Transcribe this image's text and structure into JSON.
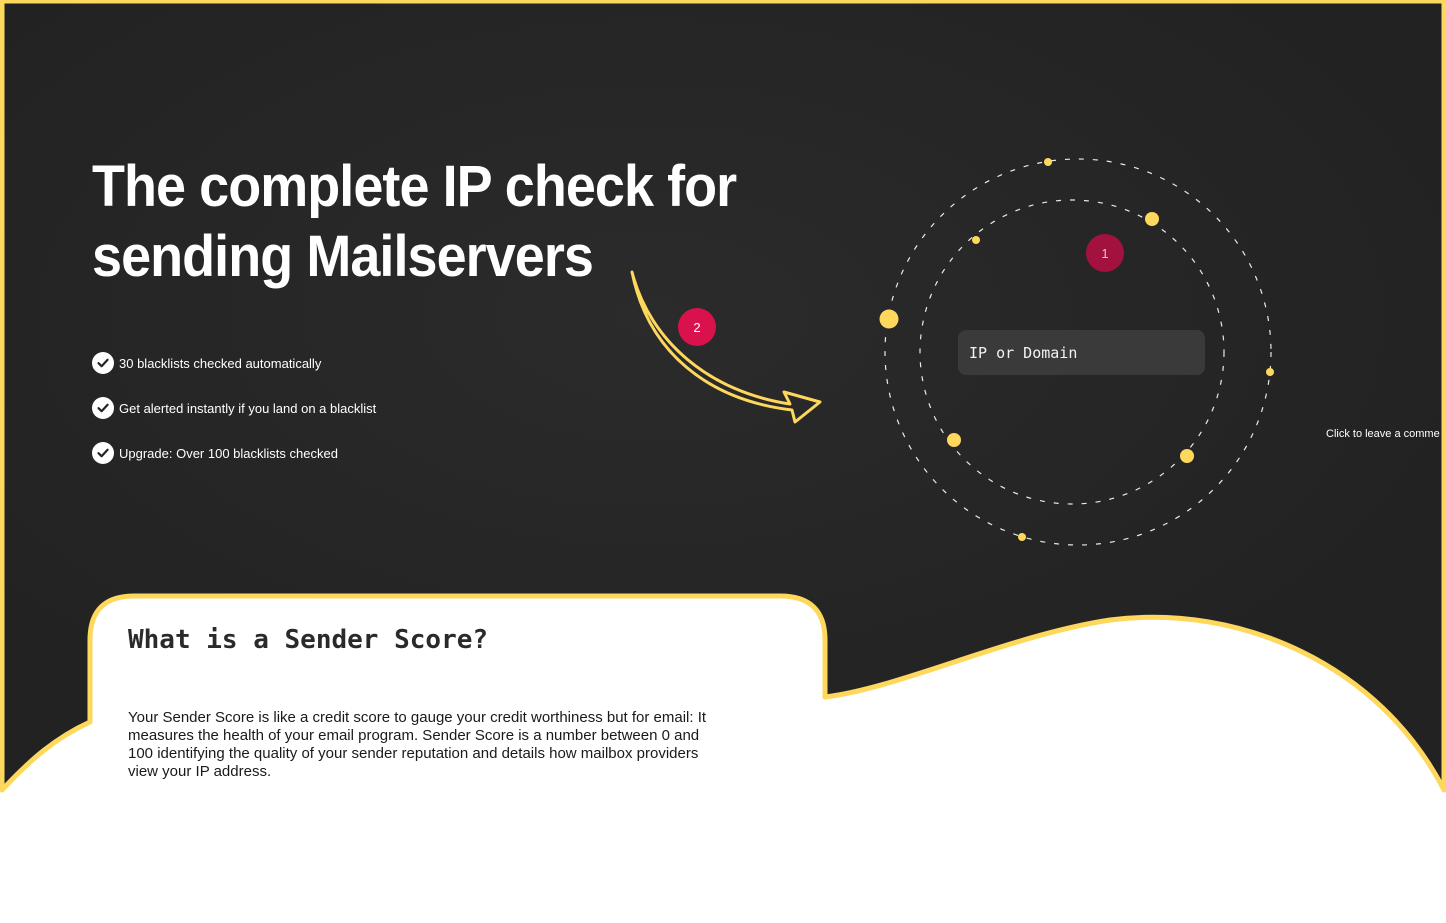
{
  "hero": {
    "title_line1": "The complete IP check for",
    "title_line2": "sending Mailservers",
    "features": [
      "30 blacklists checked automatically",
      "Get alerted instantly if you land on a blacklist",
      "Upgrade: Over 100 blacklists checked"
    ]
  },
  "checker": {
    "placeholder": "IP or Domain"
  },
  "badges": {
    "one": "1",
    "two": "2"
  },
  "comment_hint": "Click to leave a comme",
  "sender_score": {
    "title": "What is a Sender Score?",
    "body": "Your Sender Score is like a credit score to gauge your credit worthiness but for email: It measures the health of your email program. Sender Score is a number between 0 and 100 identifying the quality of your sender reputation and details how mailbox providers view your IP address."
  },
  "colors": {
    "background_dark": "#242424",
    "accent_yellow": "#fdd85d",
    "badge_dark_red": "#a3123e",
    "badge_red": "#d9124e"
  },
  "icons": [
    "check-circle-icon",
    "curved-arrow-icon"
  ]
}
